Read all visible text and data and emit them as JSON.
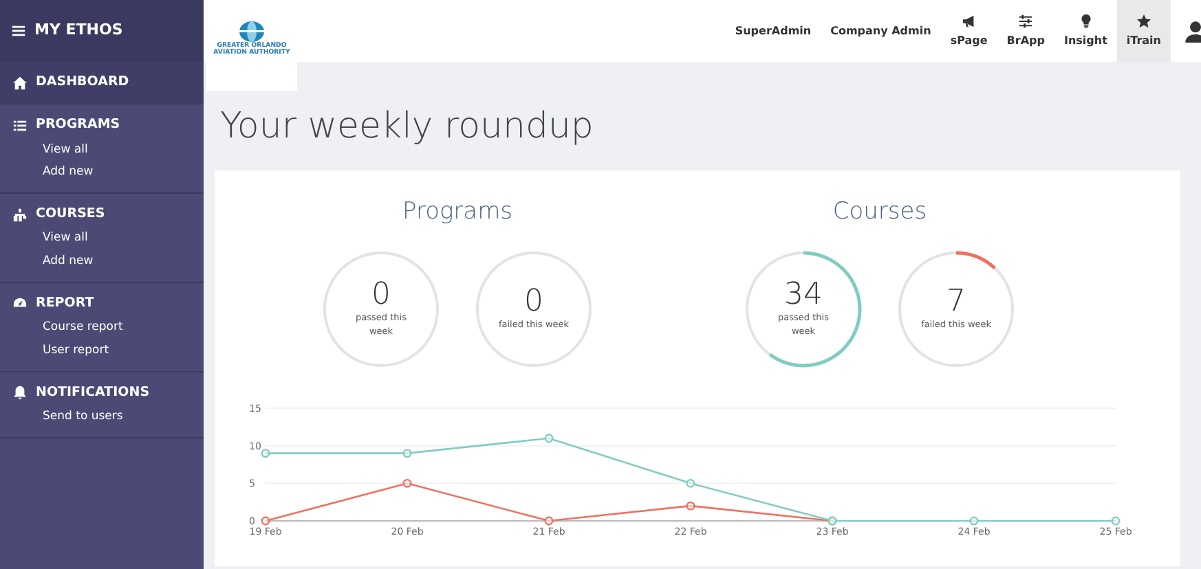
{
  "sidebar": {
    "title": "MY ETHOS",
    "sections": [
      {
        "label": "DASHBOARD",
        "selected": true
      },
      {
        "label": "PROGRAMS",
        "selected": false,
        "links": [
          "View all",
          "Add new"
        ]
      },
      {
        "label": "COURSES",
        "selected": false,
        "links": [
          "View all",
          "Add new"
        ]
      },
      {
        "label": "REPORT",
        "selected": false,
        "links": [
          "Course report",
          "User report"
        ]
      },
      {
        "label": "NOTIFICATIONS",
        "selected": false,
        "links": [
          "Send to users"
        ]
      }
    ]
  },
  "logo": {
    "lines": [
      "GREATER ORLANDO",
      "AVIATION AUTHORITY"
    ]
  },
  "topnav": [
    {
      "label": "SuperAdmin",
      "selected": false
    },
    {
      "label": "Company Admin",
      "selected": false
    },
    {
      "label": "sPage",
      "selected": false
    },
    {
      "label": "BrApp",
      "selected": false
    },
    {
      "label": "Insight",
      "selected": false
    },
    {
      "label": "iTrain",
      "selected": true
    }
  ],
  "heading": "Your weekly roundup",
  "groups": [
    {
      "title": "Programs",
      "stats": [
        {
          "value": "0",
          "caption": "passed this week",
          "kind": "passed"
        },
        {
          "value": "0",
          "caption": "failed this week",
          "kind": "failed"
        }
      ]
    },
    {
      "title": "Courses",
      "stats": [
        {
          "value": "34",
          "caption": "passed this week",
          "kind": "passed"
        },
        {
          "value": "7",
          "caption": "failed this week",
          "kind": "failed"
        }
      ]
    }
  ],
  "chart_data": {
    "type": "line",
    "categories": [
      "19 Feb",
      "20 Feb",
      "21 Feb",
      "22 Feb",
      "23 Feb",
      "24 Feb",
      "25 Feb"
    ],
    "yticks": [
      0,
      5,
      10,
      15
    ],
    "ylim": [
      0,
      15
    ],
    "series": [
      {
        "color": "#7fcdc0",
        "marker": "circle",
        "values": [
          9,
          9,
          11,
          5,
          0,
          0,
          0
        ]
      },
      {
        "color": "#f07060",
        "marker": "circle",
        "values": [
          0,
          5,
          0,
          2,
          0,
          null,
          null
        ]
      }
    ]
  }
}
